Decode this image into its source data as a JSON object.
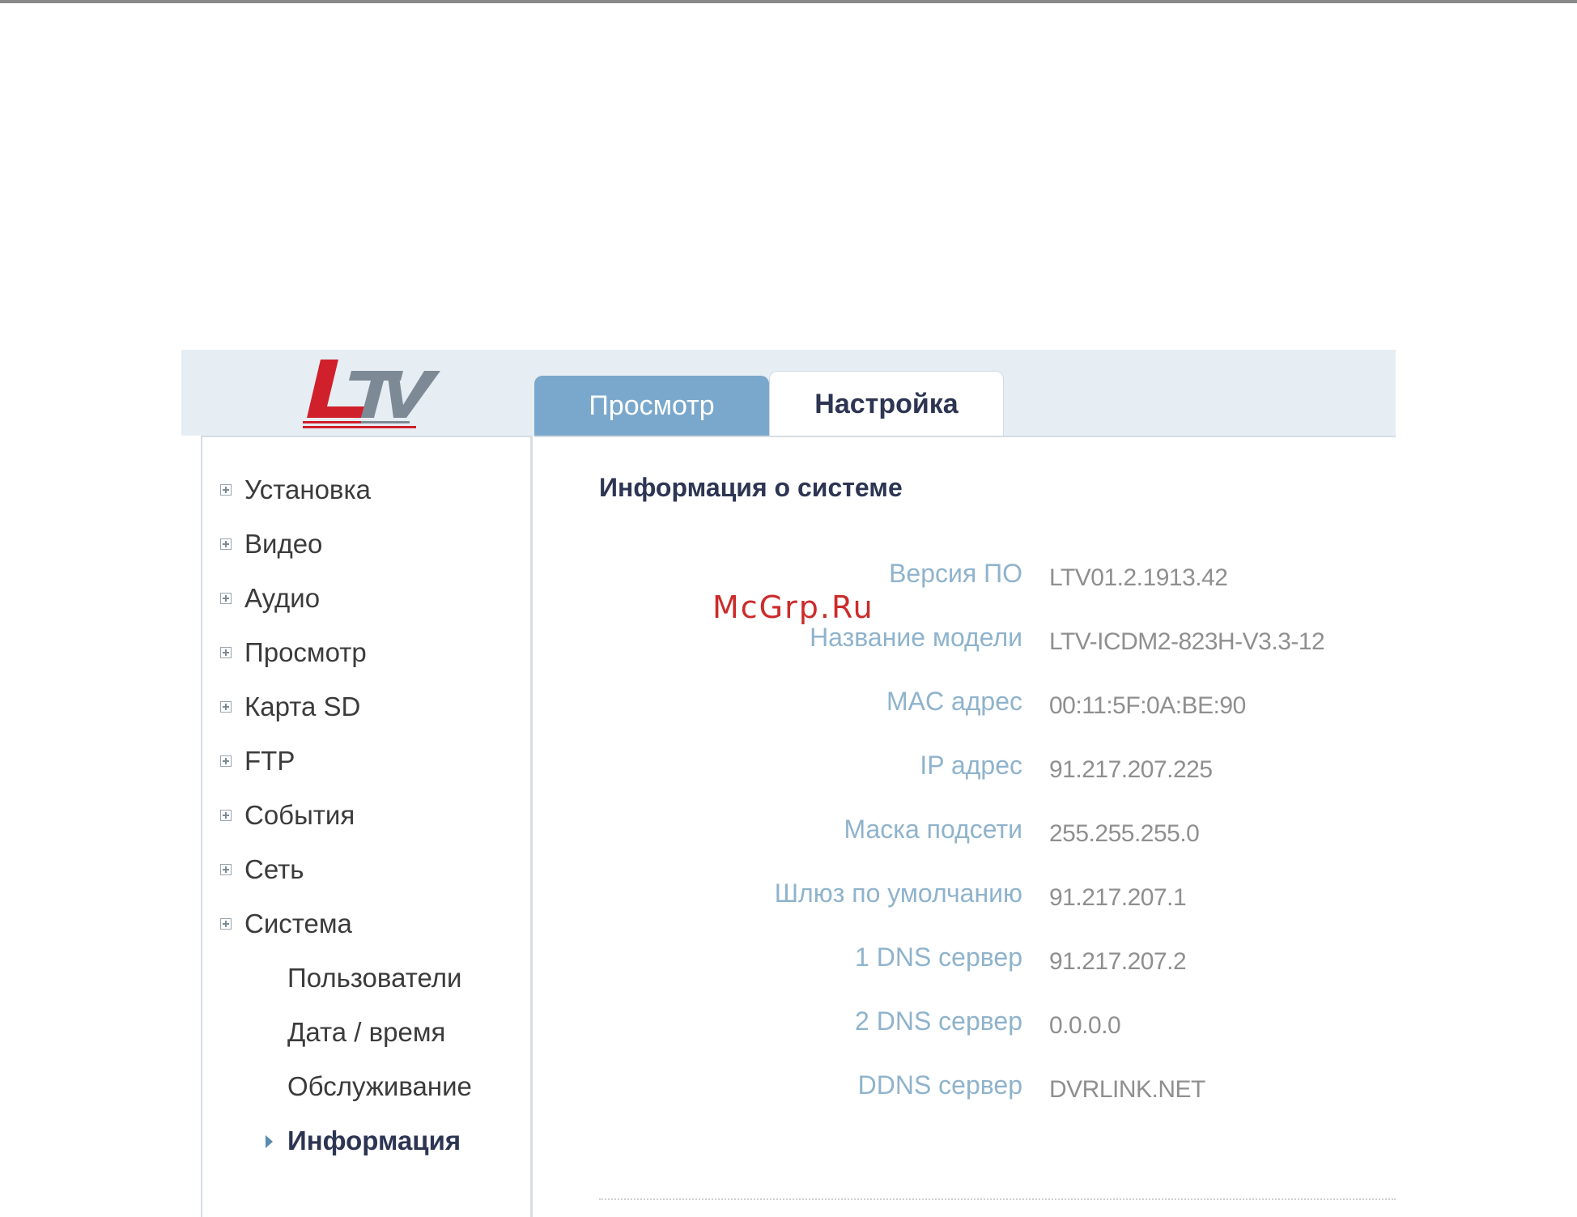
{
  "logo": {
    "text": "LTV",
    "color": "#d0202c",
    "secondary_color": "#7d8a96"
  },
  "tabs": [
    {
      "label": "Просмотр",
      "active": false
    },
    {
      "label": "Настройка",
      "active": true
    }
  ],
  "sidebar": {
    "items": [
      {
        "label": "Установка"
      },
      {
        "label": "Видео"
      },
      {
        "label": "Аудио"
      },
      {
        "label": "Просмотр"
      },
      {
        "label": "Карта SD"
      },
      {
        "label": "FTP"
      },
      {
        "label": "События"
      },
      {
        "label": "Сеть"
      },
      {
        "label": "Система"
      }
    ],
    "subitems": [
      {
        "label": "Пользователи"
      },
      {
        "label": "Дата / время"
      },
      {
        "label": "Обслуживание"
      },
      {
        "label": "Информация",
        "active": true
      }
    ]
  },
  "main": {
    "title": "Информация о системе",
    "rows": [
      {
        "label": "Версия ПО",
        "value": "LTV01.2.1913.42"
      },
      {
        "label": "Название модели",
        "value": "LTV-ICDM2-823H-V3.3-12"
      },
      {
        "label": "MAC адрес",
        "value": "00:11:5F:0A:BE:90"
      },
      {
        "label": "IP адрес",
        "value": "91.217.207.225"
      },
      {
        "label": "Маска подсети",
        "value": "255.255.255.0"
      },
      {
        "label": "Шлюз по умолчанию",
        "value": "91.217.207.1"
      },
      {
        "label": "1 DNS сервер",
        "value": "91.217.207.2"
      },
      {
        "label": "2 DNS сервер",
        "value": "0.0.0.0"
      },
      {
        "label": "DDNS сервер",
        "value": "DVRLINK.NET"
      }
    ]
  },
  "watermark": "McGrp.Ru",
  "colors": {
    "tab_inactive": "#7aa8cc",
    "label": "#8fb3cc",
    "title": "#2d3553",
    "header_bg": "#e6eef4"
  }
}
